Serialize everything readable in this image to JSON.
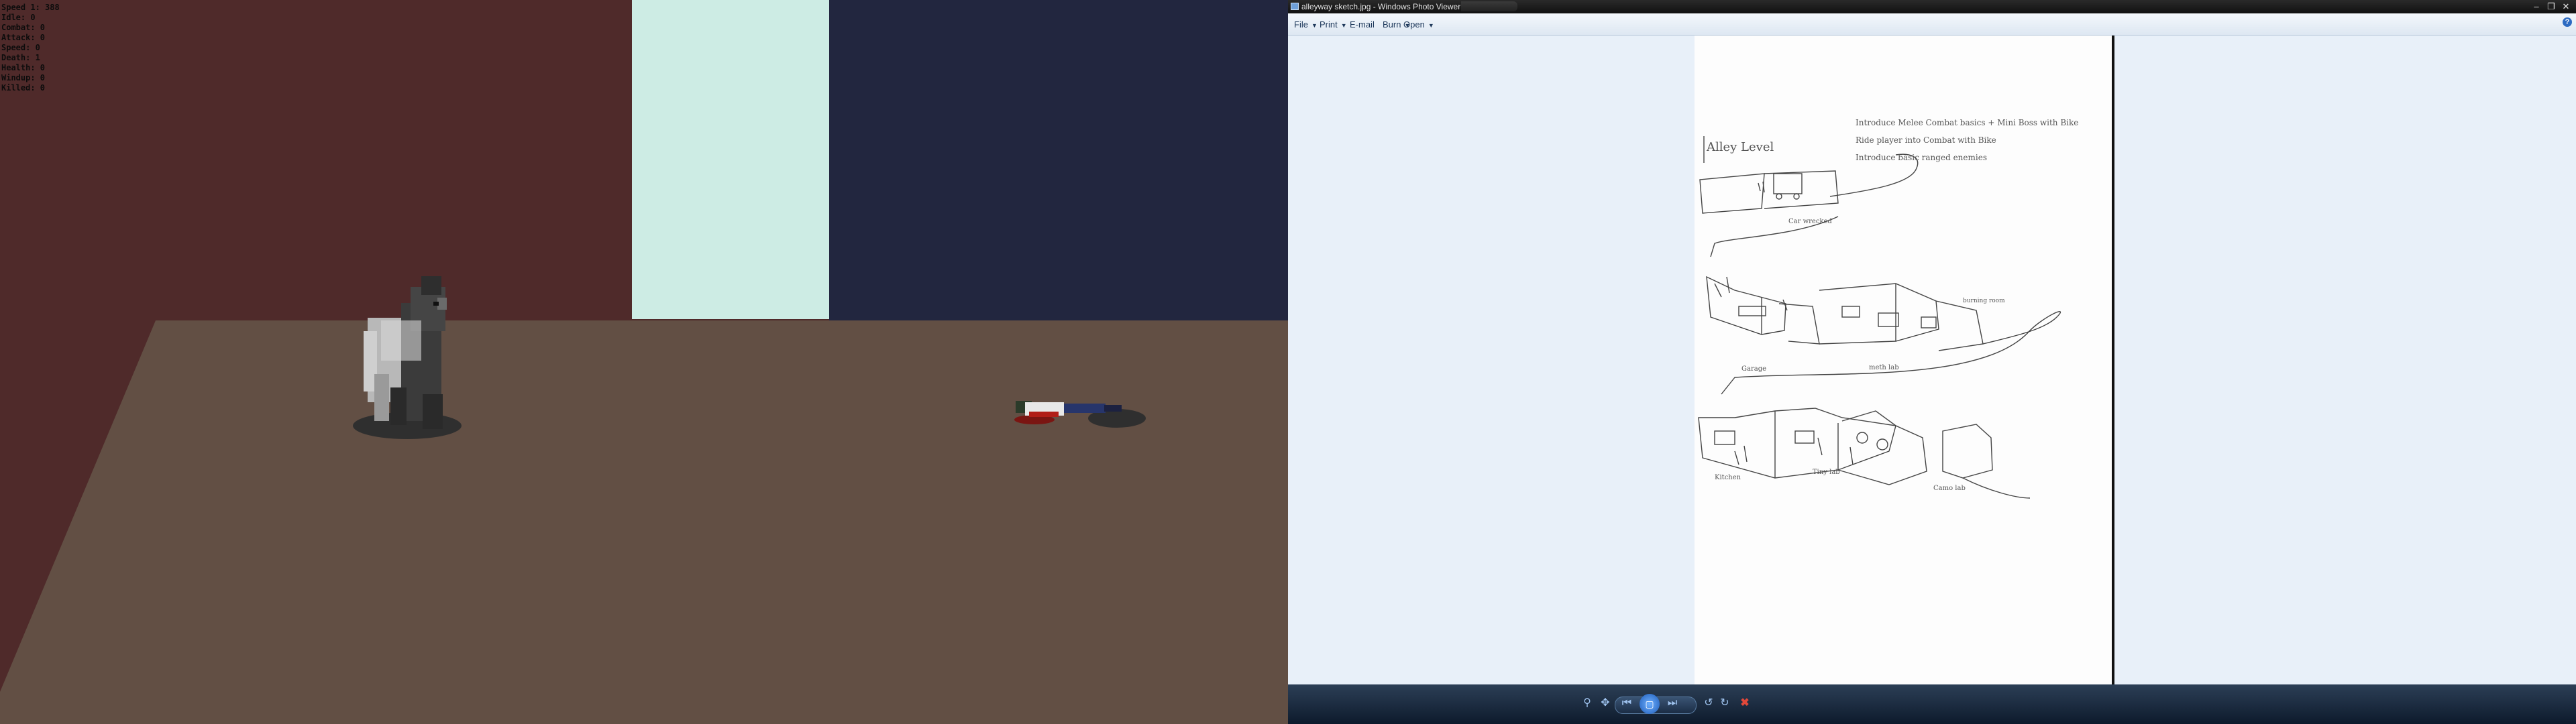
{
  "game": {
    "hud": [
      "Speed 1: 388",
      "Idle: 0",
      "Combat: 0",
      "Attack: 0",
      "Speed: 0",
      "Death: 1",
      "Health: 0",
      "Windup: 0",
      "Killed: 0"
    ],
    "colors": {
      "wall_left": "#4f2a2a",
      "wall_light": "#cdece4",
      "wall_dark": "#22263f",
      "floor": "#624f44"
    }
  },
  "viewer": {
    "window_title": "alleyway sketch.jpg - Windows Photo Viewer",
    "menu": {
      "file": "File",
      "print": "Print",
      "email": "E-mail",
      "burn": "Burn",
      "open": "Open"
    },
    "sketch": {
      "heading": "Alley Level",
      "notes": [
        "Introduce Melee Combat basics + Mini Boss with Bike",
        "Ride player into Combat with Bike",
        "Introduce basic ranged enemies"
      ],
      "labels": {
        "car": "Car wrecked",
        "garage": "Garage",
        "meth_lab": "meth lab",
        "kitchen": "Kitchen",
        "tiny_lab": "Tiny lab",
        "camo_lab": "Camo lab",
        "burning": "burning room"
      }
    },
    "controls": [
      "magnify-icon",
      "actual-size-icon",
      "previous-icon",
      "slideshow-icon",
      "next-icon",
      "rotate-ccw-icon",
      "rotate-cw-icon",
      "delete-icon"
    ]
  }
}
